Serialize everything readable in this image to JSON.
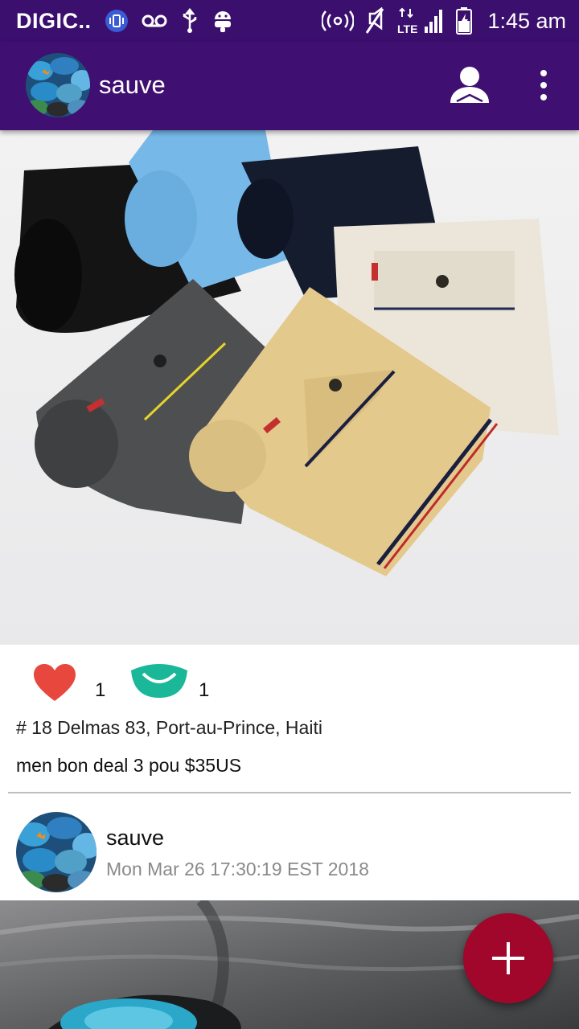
{
  "status_bar": {
    "carrier": "DIGIC..",
    "time": "1:45 am",
    "icons": [
      "vibrate-icon",
      "voicemail-icon",
      "usb-icon",
      "android-debug-icon",
      "hotspot-icon",
      "mute-icon",
      "lte-signal-icon",
      "battery-charging-icon"
    ],
    "network_label": "LTE"
  },
  "app_bar": {
    "username": "sauve",
    "background_color": "#3f1071",
    "icons": [
      "profile-icon",
      "more-options-icon"
    ]
  },
  "post": {
    "image_description_icon": "folded-pants-photo",
    "likes": "1",
    "views": "1",
    "like_icon_color": "#e8473d",
    "view_icon_color": "#1ab899",
    "location": "# 18 Delmas 83, Port-au-Prince, Haiti",
    "caption": "men bon deal 3 pou $35US",
    "author": {
      "name": "sauve",
      "timestamp": "Mon Mar 26 17:30:19 EST 2018"
    }
  },
  "fab": {
    "icon": "plus-icon",
    "color": "#a0072b"
  }
}
